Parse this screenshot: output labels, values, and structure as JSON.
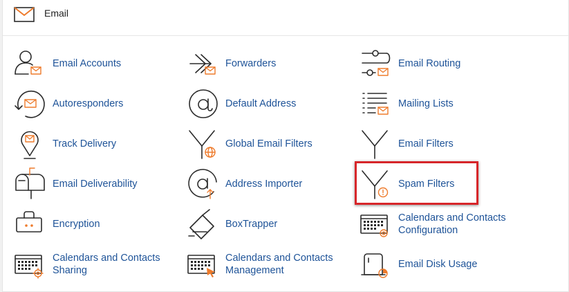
{
  "section": {
    "title": "Email",
    "icon": "envelope-icon"
  },
  "accent_color": "#ee7b2c",
  "link_color": "#1e5398",
  "highlight_color": "#d7262a",
  "items": {
    "email_accounts": {
      "label": "Email Accounts",
      "icon": "user-mail-icon"
    },
    "forwarders": {
      "label": "Forwarders",
      "icon": "forward-arrow-icon"
    },
    "email_routing": {
      "label": "Email Routing",
      "icon": "routing-switches-icon"
    },
    "autoresponders": {
      "label": "Autoresponders",
      "icon": "refresh-mail-icon"
    },
    "default_address": {
      "label": "Default Address",
      "icon": "at-sign-icon"
    },
    "mailing_lists": {
      "label": "Mailing Lists",
      "icon": "list-mail-icon"
    },
    "track_delivery": {
      "label": "Track Delivery",
      "icon": "location-pin-mail-icon"
    },
    "global_email_filters": {
      "label": "Global Email Filters",
      "icon": "filter-globe-icon"
    },
    "email_filters": {
      "label": "Email Filters",
      "icon": "filter-icon"
    },
    "email_deliverability": {
      "label": "Email Deliverability",
      "icon": "mailbox-icon"
    },
    "address_importer": {
      "label": "Address Importer",
      "icon": "at-sign-upload-icon"
    },
    "spam_filters": {
      "label": "Spam Filters",
      "icon": "filter-warning-icon"
    },
    "encryption": {
      "label": "Encryption",
      "icon": "lock-icon"
    },
    "boxtrapper": {
      "label": "BoxTrapper",
      "icon": "box-trap-icon"
    },
    "calendars_contacts_configuration": {
      "label": "Calendars and Contacts Configuration",
      "icon": "calendar-at-icon"
    },
    "calendars_contacts_sharing": {
      "label": "Calendars and Contacts Sharing",
      "icon": "calendar-gear-icon"
    },
    "calendars_contacts_management": {
      "label": "Calendars and Contacts Management",
      "icon": "calendar-cursor-icon"
    },
    "email_disk_usage": {
      "label": "Email Disk Usage",
      "icon": "disk-usage-icon"
    }
  }
}
